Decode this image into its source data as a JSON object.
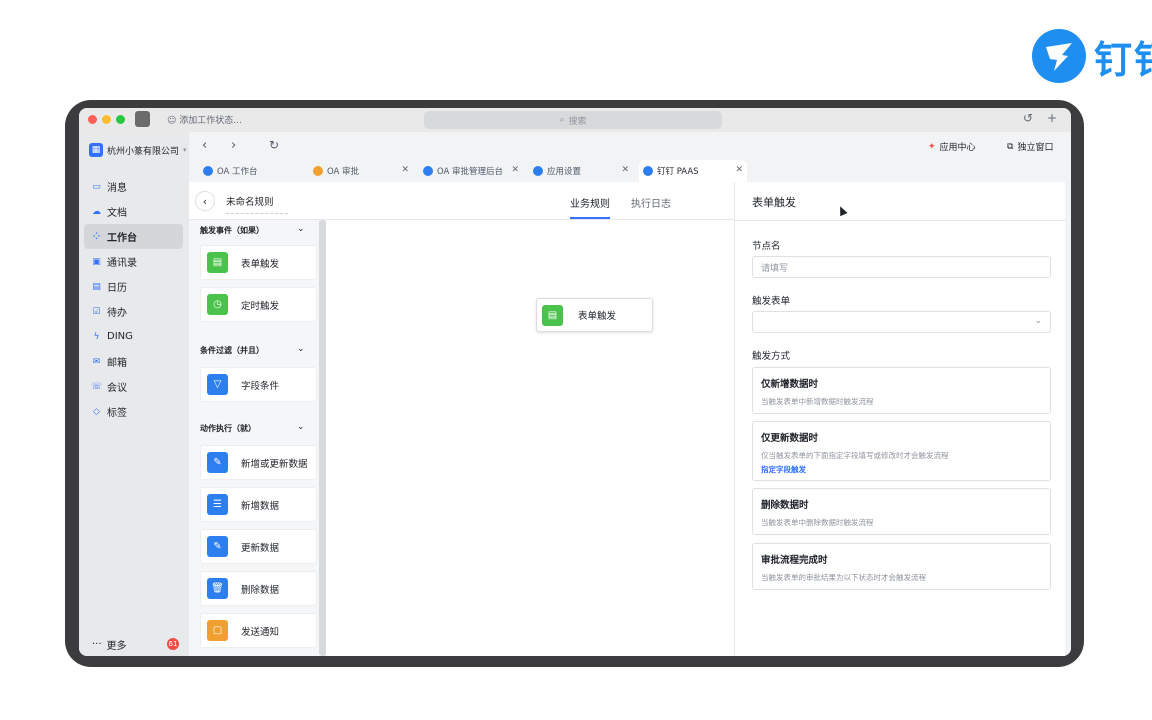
{
  "brand": {
    "text": "钉钉",
    "color": "#1e8ef0"
  },
  "titlebar": {
    "status": "添加工作状态...",
    "search_placeholder": "搜索"
  },
  "sidebar": {
    "org": "杭州小篆有限公司",
    "items": [
      {
        "icon": "message-icon",
        "label": "消息"
      },
      {
        "icon": "doc-icon",
        "label": "文档"
      },
      {
        "icon": "workspace-icon",
        "label": "工作台"
      },
      {
        "icon": "contacts-icon",
        "label": "通讯录"
      },
      {
        "icon": "calendar-icon",
        "label": "日历"
      },
      {
        "icon": "todo-icon",
        "label": "待办"
      },
      {
        "icon": "ding-icon",
        "label": "DING"
      },
      {
        "icon": "mail-icon",
        "label": "邮箱"
      },
      {
        "icon": "meeting-icon",
        "label": "会议"
      },
      {
        "icon": "tag-icon",
        "label": "标签"
      }
    ],
    "more": "更多",
    "badge": "61"
  },
  "toolbar": {
    "app_center": "应用中心",
    "standalone": "独立窗口"
  },
  "tabs": [
    {
      "label": "OA 工作台",
      "color": "#2d7ff0"
    },
    {
      "label": "OA 审批",
      "color": "#f0a030"
    },
    {
      "label": "OA 审批管理后台",
      "color": "#2d7ff0"
    },
    {
      "label": "应用设置",
      "color": "#2d7ff0"
    },
    {
      "label": "钉钉 PAAS",
      "color": "#2d7ff0"
    }
  ],
  "header": {
    "rule_name": "未命名规则",
    "tab_rules": "业务规则",
    "tab_logs": "执行日志"
  },
  "panel": {
    "sections": [
      {
        "title": "触发事件（如果）",
        "items": [
          {
            "label": "表单触发",
            "color": "green",
            "icon": "form-icon"
          },
          {
            "label": "定时触发",
            "color": "green",
            "icon": "clock-icon"
          }
        ]
      },
      {
        "title": "条件过滤（并且）",
        "items": [
          {
            "label": "字段条件",
            "color": "blue",
            "icon": "filter-icon"
          }
        ]
      },
      {
        "title": "动作执行（就）",
        "items": [
          {
            "label": "新增或更新数据",
            "color": "blue",
            "icon": "edit-icon"
          },
          {
            "label": "新增数据",
            "color": "blue",
            "icon": "add-list-icon"
          },
          {
            "label": "更新数据",
            "color": "blue",
            "icon": "edit-icon"
          },
          {
            "label": "删除数据",
            "color": "blue",
            "icon": "trash-icon"
          },
          {
            "label": "发送通知",
            "color": "orange",
            "icon": "notify-icon"
          }
        ]
      }
    ]
  },
  "canvas": {
    "node_label": "表单触发"
  },
  "config": {
    "title": "表单触发",
    "node_name_label": "节点名",
    "node_name_placeholder": "请填写",
    "trigger_form_label": "触发表单",
    "trigger_mode_label": "触发方式",
    "options": [
      {
        "title": "仅新增数据时",
        "desc": "当触发表单中新增数据时触发流程"
      },
      {
        "title": "仅更新数据时",
        "desc": "仅当触发表单的下面指定字段填写或修改时才会触发流程",
        "link": "指定字段触发"
      },
      {
        "title": "删除数据时",
        "desc": "当触发表单中删除数据时触发流程"
      },
      {
        "title": "审批流程完成时",
        "desc": "当触发表单的审批结果为以下状态时才会触发流程"
      }
    ]
  }
}
